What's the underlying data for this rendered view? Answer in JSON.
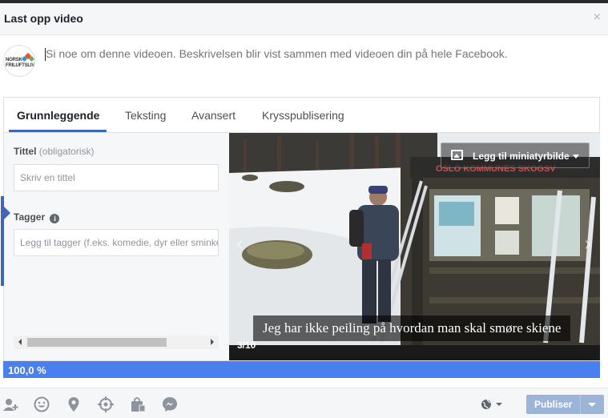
{
  "dialog": {
    "title": "Last opp video",
    "close_glyph": "×"
  },
  "composer": {
    "avatar_text_line1": "NORSK",
    "avatar_text_line2": "FRILUFTSLIV",
    "description_placeholder": "Si noe om denne videoen. Beskrivelsen blir vist sammen med videoen din på hele Facebook."
  },
  "tabs": [
    {
      "label": "Grunnleggende",
      "active": true
    },
    {
      "label": "Teksting",
      "active": false
    },
    {
      "label": "Avansert",
      "active": false
    },
    {
      "label": "Krysspublisering",
      "active": false
    }
  ],
  "form": {
    "title_label": "Tittel",
    "title_hint": "(obligatorisk)",
    "title_placeholder": "Skriv en tittel",
    "tags_label": "Tagger",
    "tags_info_glyph": "i",
    "tags_placeholder": "Legg til tagger (f.eks. komedie, dyr eller sminke)"
  },
  "video": {
    "thumbnail_button": "Legg til miniatyrbilde",
    "subtitle": "Jeg har ikke peiling på hvordan man skal smøre skiene",
    "counter": "3/10",
    "sign_text": "OSLO KOMMUNES SKOGSV"
  },
  "upload": {
    "progress_text": "100,0 %",
    "progress": 1.0
  },
  "footer": {
    "icons": [
      "tag-people-icon",
      "feeling-icon",
      "location-icon",
      "target-icon",
      "shopping-bag-icon",
      "messenger-icon"
    ],
    "privacy_icon": "globe-icon",
    "publish_label": "Publiser"
  },
  "colors": {
    "accent": "#4267b2",
    "progress": "#4a7ff0",
    "publish_disabled": "#9cb4d8"
  }
}
